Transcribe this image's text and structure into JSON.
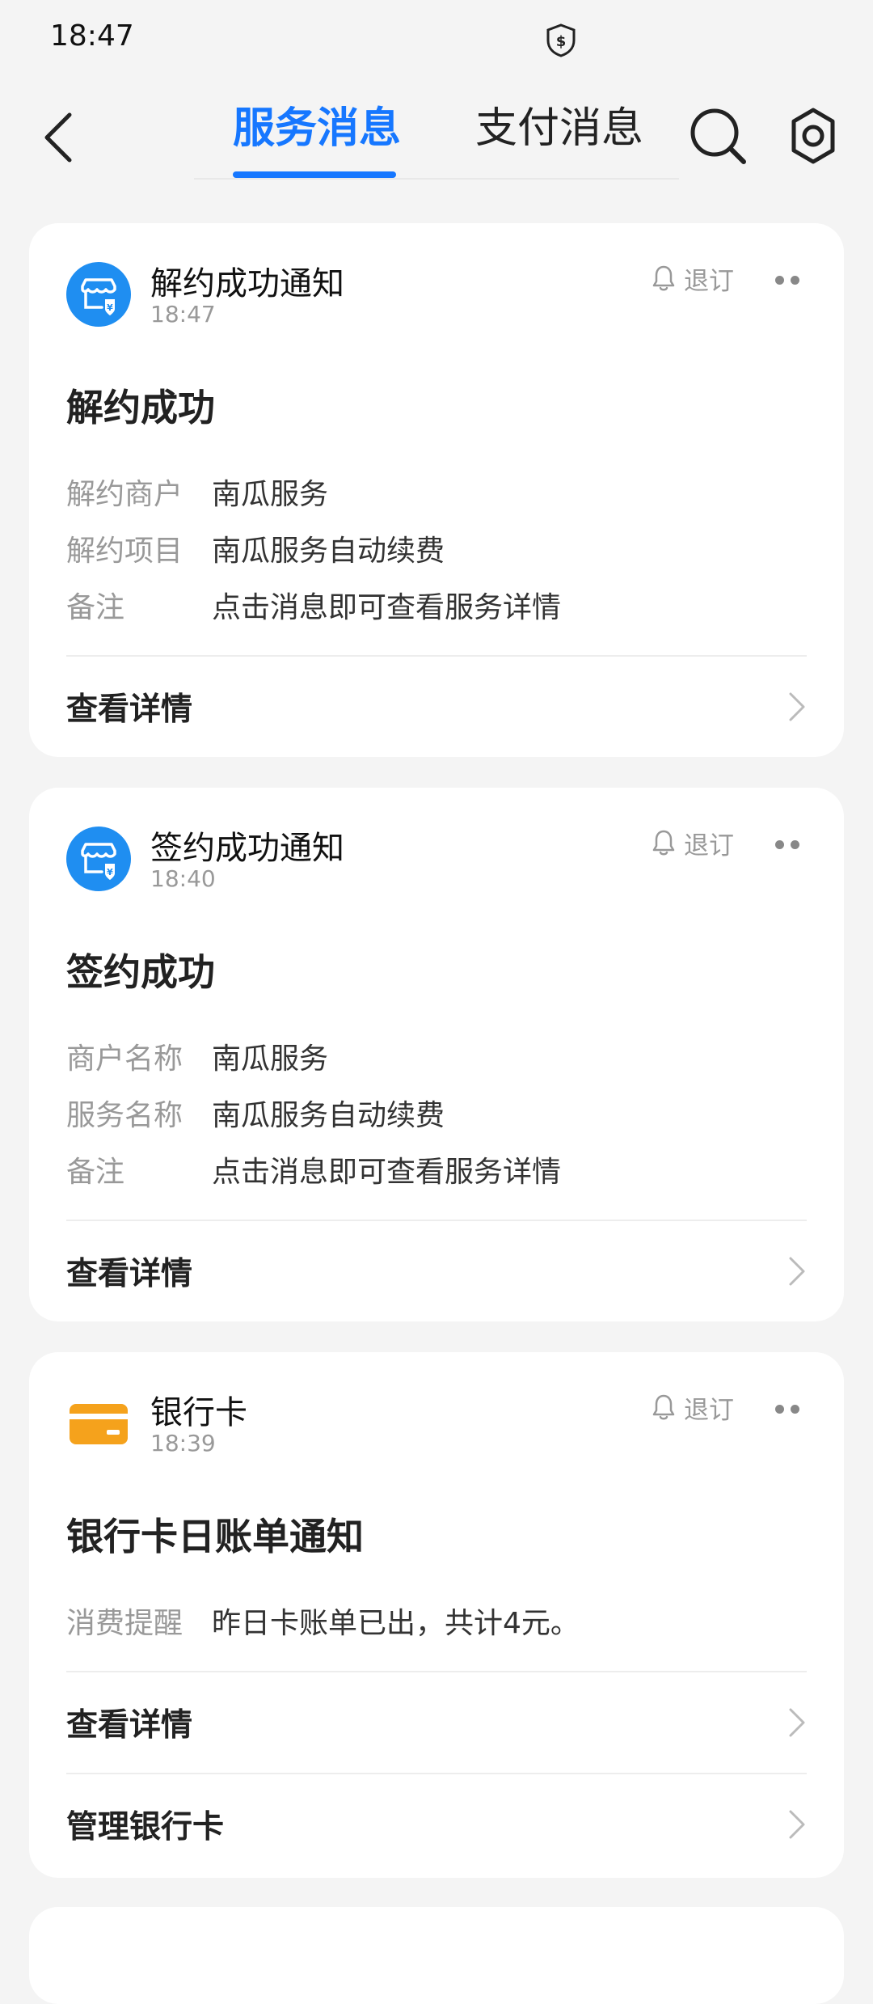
{
  "status_bar": {
    "time": "18:47",
    "icon": "shield-dollar-icon"
  },
  "header": {
    "tabs": [
      {
        "label": "服务消息",
        "active": true
      },
      {
        "label": "支付消息",
        "active": false
      }
    ],
    "accent_color": "#1677ff"
  },
  "cards": [
    {
      "icon": "store-yuan-icon",
      "title": "解约成功通知",
      "time": "18:47",
      "unsubscribe_label": "退订",
      "heading": "解约成功",
      "fields": [
        {
          "label": "解约商户",
          "value": "南瓜服务"
        },
        {
          "label": "解约项目",
          "value": "南瓜服务自动续费"
        },
        {
          "label": "备注",
          "value": "点击消息即可查看服务详情"
        }
      ],
      "actions": [
        {
          "label": "查看详情"
        }
      ]
    },
    {
      "icon": "store-yuan-icon",
      "title": "签约成功通知",
      "time": "18:40",
      "unsubscribe_label": "退订",
      "heading": "签约成功",
      "fields": [
        {
          "label": "商户名称",
          "value": "南瓜服务"
        },
        {
          "label": "服务名称",
          "value": "南瓜服务自动续费"
        },
        {
          "label": "备注",
          "value": "点击消息即可查看服务详情"
        }
      ],
      "actions": [
        {
          "label": "查看详情"
        }
      ]
    },
    {
      "icon": "bank-card-icon",
      "title": "银行卡",
      "time": "18:39",
      "unsubscribe_label": "退订",
      "heading": "银行卡日账单通知",
      "fields": [
        {
          "label": "消费提醒",
          "value": "昨日卡账单已出，共计4元。"
        }
      ],
      "actions": [
        {
          "label": "查看详情"
        },
        {
          "label": "管理银行卡"
        }
      ]
    }
  ]
}
